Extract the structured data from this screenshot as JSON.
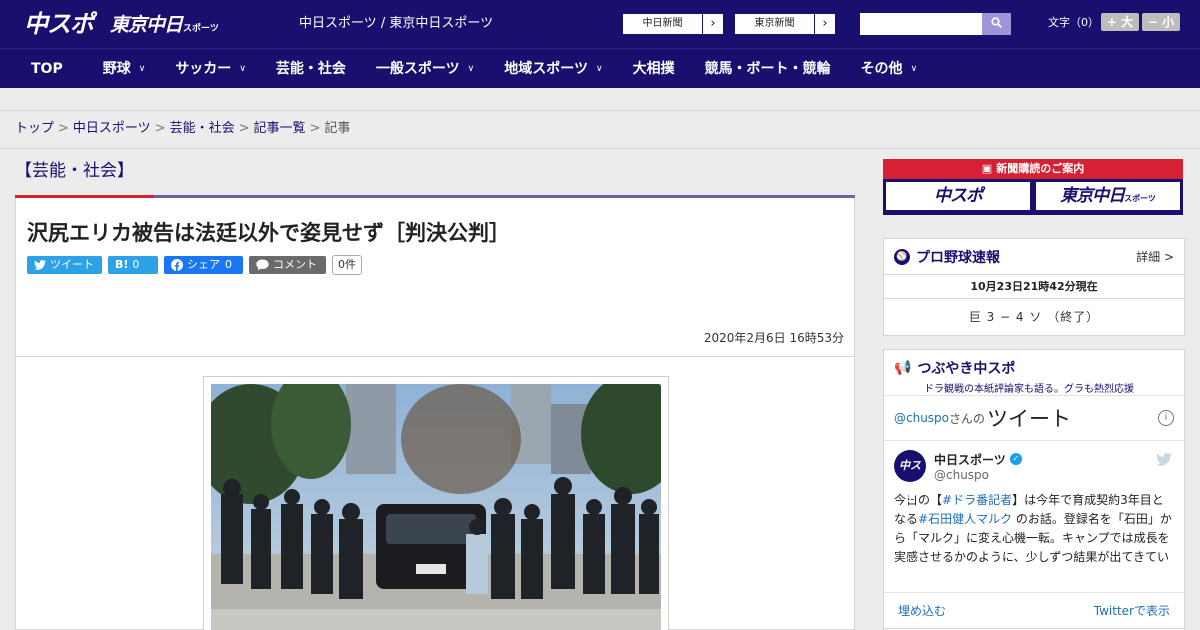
{
  "header": {
    "logo_main": "中スポ",
    "logo_tokyo": "東京中日",
    "logo_tokyo_sub": "スポーツ",
    "site_title": "中日スポーツ / 東京中日スポーツ",
    "ext_links": [
      {
        "label": "中日新聞",
        "arrow": "›"
      },
      {
        "label": "東京新聞",
        "arrow": "›"
      }
    ],
    "search_placeholder": "",
    "font_size_label": "文字（0）",
    "font_large": "+ 大",
    "font_small": "− 小"
  },
  "nav": {
    "items": [
      {
        "label": "TOP",
        "has_menu": false
      },
      {
        "label": "野球",
        "has_menu": true
      },
      {
        "label": "サッカー",
        "has_menu": true
      },
      {
        "label": "芸能・社会",
        "has_menu": false
      },
      {
        "label": "一般スポーツ",
        "has_menu": true
      },
      {
        "label": "地域スポーツ",
        "has_menu": true
      },
      {
        "label": "大相撲",
        "has_menu": false
      },
      {
        "label": "競馬・ボート・競輪",
        "has_menu": false
      },
      {
        "label": "その他",
        "has_menu": true
      }
    ]
  },
  "breadcrumb": {
    "items": [
      "トップ",
      "中日スポーツ",
      "芸能・社会",
      "記事一覧"
    ],
    "current": "記事",
    "separator": ">"
  },
  "article": {
    "category": "【芸能・社会】",
    "headline": "沢尻エリカ被告は法廷以外で姿見せず［判決公判］",
    "share": {
      "tweet": "ツイート",
      "hatena_icon": "B!",
      "hatena_count": "0",
      "facebook": "シェア",
      "facebook_count": "0",
      "comment": "コメント",
      "comment_count": "0件"
    },
    "date": "2020年2月6日 16時53分"
  },
  "sidebar": {
    "promo": {
      "title": "新聞購読のご案内",
      "logo_main": "中スポ",
      "logo_tokyo": "東京中日",
      "logo_tokyo_sub": "スポーツ"
    },
    "baseball": {
      "title": "プロ野球速報",
      "more": "詳細 >",
      "time": "10月23日21時42分現在",
      "score": "巨 3 − 4 ソ （終了）"
    },
    "tweets": {
      "title": "つぶやき中スポ",
      "subtitle": "ドラ観戦の本紙評論家も語る。グラも熱烈応援",
      "handle": "@chuspo",
      "handle_suffix": "さんの",
      "heading": "ツイート",
      "user_name": "中日スポーツ",
      "user_at": "@chuspo",
      "avatar_text": "中スポ",
      "body_pre": "今日の【",
      "body_tag1": "#ドラ番記者",
      "body_mid1": "】は今年で育成契約3年目となる",
      "body_tag2": "#石田健人マルク",
      "body_mid2": " のお話。登録名を「石田」から「マルク」に変え心機一転。キャンプでは成長を実感させるかのように、少しずつ結果が出てきている",
      "embed": "埋め込む",
      "view": "Twitterで表示"
    }
  },
  "colors": {
    "brand_navy": "#1a0f6e",
    "accent_red": "#d62135",
    "twitter_blue": "#2ea2e6",
    "facebook_blue": "#1877f2"
  }
}
